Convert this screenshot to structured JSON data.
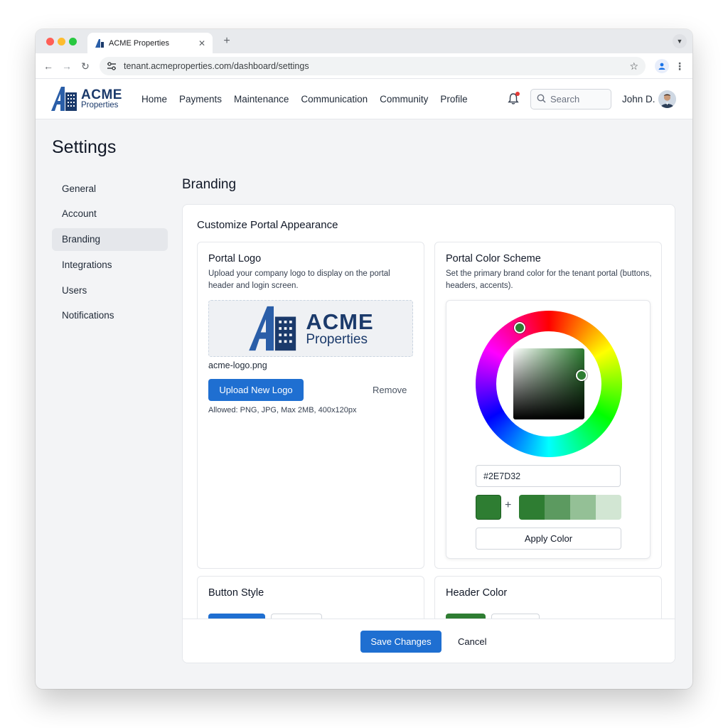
{
  "browser": {
    "tab_title": "ACME Properties",
    "url": "tenant.acmeproperties.com/dashboard/settings"
  },
  "brand": {
    "name": "ACME",
    "tagline": "Properties",
    "color": "#1b3a6b"
  },
  "nav": {
    "items": [
      {
        "label": "Home"
      },
      {
        "label": "Payments"
      },
      {
        "label": "Maintenance"
      },
      {
        "label": "Communication"
      },
      {
        "label": "Community"
      },
      {
        "label": "Profile"
      }
    ],
    "search_placeholder": "Search",
    "user_name": "John D."
  },
  "page": {
    "title": "Settings"
  },
  "sidebar": {
    "items": [
      {
        "label": "General",
        "active": false
      },
      {
        "label": "Account",
        "active": false
      },
      {
        "label": "Branding",
        "active": true
      },
      {
        "label": "Integrations",
        "active": false
      },
      {
        "label": "Users",
        "active": false
      },
      {
        "label": "Notifications",
        "active": false
      }
    ]
  },
  "branding": {
    "section_title": "Branding",
    "panel_title": "Customize Portal Appearance",
    "logo_card": {
      "title": "Portal Logo",
      "description": "Upload your company logo to display on the portal header and login screen.",
      "logo_name": "ACME",
      "logo_tagline": "Properties",
      "filename": "acme-logo.png",
      "upload_label": "Upload New Logo",
      "remove_label": "Remove",
      "allowed": "Allowed: PNG, JPG, Max 2MB, 400x120px"
    },
    "color_card": {
      "title": "Portal Color Scheme",
      "description": "Set the primary brand color for the tenant portal (buttons, headers, accents).",
      "hex_value": "#2E7D32",
      "selected_color": "#2E7D32",
      "shades": [
        "#2e7d32",
        "#5c9a60",
        "#94c096",
        "#d2e6d3"
      ],
      "apply_label": "Apply Color"
    },
    "button_style_card": {
      "title": "Button Style"
    },
    "header_color_card": {
      "title": "Header Color"
    },
    "save_label": "Save Changes",
    "cancel_label": "Cancel"
  }
}
